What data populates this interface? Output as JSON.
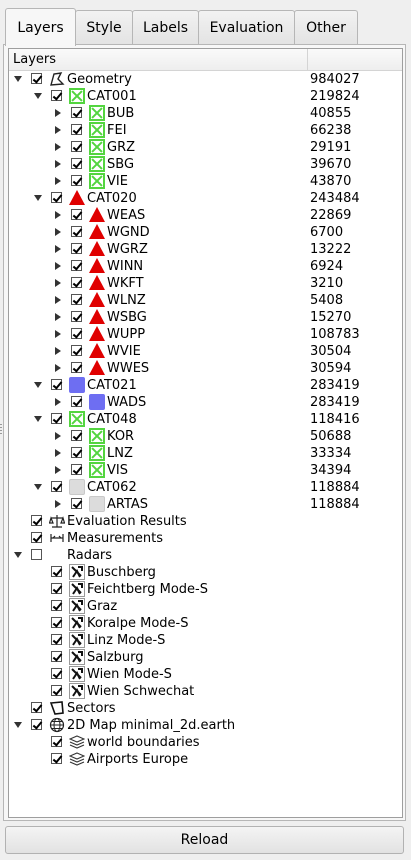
{
  "tabs": [
    {
      "label": "Layers",
      "active": true
    },
    {
      "label": "Style"
    },
    {
      "label": "Labels"
    },
    {
      "label": "Evaluation"
    },
    {
      "label": "Other"
    }
  ],
  "tree_header": "Layers",
  "rows": [
    {
      "label": "Geometry",
      "count": "984027",
      "icon": "geometry-icon"
    },
    {
      "label": "CAT001",
      "count": "219824",
      "icon": "green-x-icon"
    },
    {
      "label": "BUB",
      "count": "40855",
      "icon": "green-x-icon"
    },
    {
      "label": "FEI",
      "count": "66238",
      "icon": "green-x-icon"
    },
    {
      "label": "GRZ",
      "count": "29191",
      "icon": "green-x-icon"
    },
    {
      "label": "SBG",
      "count": "39670",
      "icon": "green-x-icon"
    },
    {
      "label": "VIE",
      "count": "43870",
      "icon": "green-x-icon"
    },
    {
      "label": "CAT020",
      "count": "243484",
      "icon": "red-triangle-icon"
    },
    {
      "label": "WEAS",
      "count": "22869",
      "icon": "red-triangle-icon"
    },
    {
      "label": "WGND",
      "count": "6700",
      "icon": "red-triangle-icon"
    },
    {
      "label": "WGRZ",
      "count": "13222",
      "icon": "red-triangle-icon"
    },
    {
      "label": "WINN",
      "count": "6924",
      "icon": "red-triangle-icon"
    },
    {
      "label": "WKFT",
      "count": "3210",
      "icon": "red-triangle-icon"
    },
    {
      "label": "WLNZ",
      "count": "5408",
      "icon": "red-triangle-icon"
    },
    {
      "label": "WSBG",
      "count": "15270",
      "icon": "red-triangle-icon"
    },
    {
      "label": "WUPP",
      "count": "108783",
      "icon": "red-triangle-icon"
    },
    {
      "label": "WVIE",
      "count": "30504",
      "icon": "red-triangle-icon"
    },
    {
      "label": "WWES",
      "count": "30594",
      "icon": "red-triangle-icon"
    },
    {
      "label": "CAT021",
      "count": "283419",
      "icon": "blue-square-icon"
    },
    {
      "label": "WADS",
      "count": "283419",
      "icon": "blue-square-icon"
    },
    {
      "label": "CAT048",
      "count": "118416",
      "icon": "green-x-icon"
    },
    {
      "label": "KOR",
      "count": "50688",
      "icon": "green-x-icon"
    },
    {
      "label": "LNZ",
      "count": "33334",
      "icon": "green-x-icon"
    },
    {
      "label": "VIS",
      "count": "34394",
      "icon": "green-x-icon"
    },
    {
      "label": "CAT062",
      "count": "118884",
      "icon": "gray-square-icon"
    },
    {
      "label": "ARTAS",
      "count": "118884",
      "icon": "gray-square-icon"
    },
    {
      "label": "Evaluation Results",
      "count": "",
      "icon": "scale-icon"
    },
    {
      "label": "Measurements",
      "count": "",
      "icon": "ruler-icon"
    },
    {
      "label": "Radars",
      "count": "",
      "icon": ""
    },
    {
      "label": "Buschberg",
      "count": "",
      "icon": "radar-icon"
    },
    {
      "label": "Feichtberg Mode-S",
      "count": "",
      "icon": "radar-icon"
    },
    {
      "label": "Graz",
      "count": "",
      "icon": "radar-icon"
    },
    {
      "label": "Koralpe Mode-S",
      "count": "",
      "icon": "radar-icon"
    },
    {
      "label": "Linz Mode-S",
      "count": "",
      "icon": "radar-icon"
    },
    {
      "label": "Salzburg",
      "count": "",
      "icon": "radar-icon"
    },
    {
      "label": "Wien Mode-S",
      "count": "",
      "icon": "radar-icon"
    },
    {
      "label": "Wien Schwechat",
      "count": "",
      "icon": "radar-icon"
    },
    {
      "label": "Sectors",
      "count": "",
      "icon": "sector-icon"
    },
    {
      "label": "2D Map minimal_2d.earth",
      "count": "",
      "icon": "globe-icon"
    },
    {
      "label": "world boundaries",
      "count": "",
      "icon": "layers-icon"
    },
    {
      "label": "Airports Europe",
      "count": "",
      "icon": "layers-icon"
    }
  ],
  "reload_label": "Reload",
  "colors": {
    "green": "#53d53f",
    "red": "#e00000",
    "blue": "#6e6ef2",
    "gray": "#dcdcdc"
  }
}
